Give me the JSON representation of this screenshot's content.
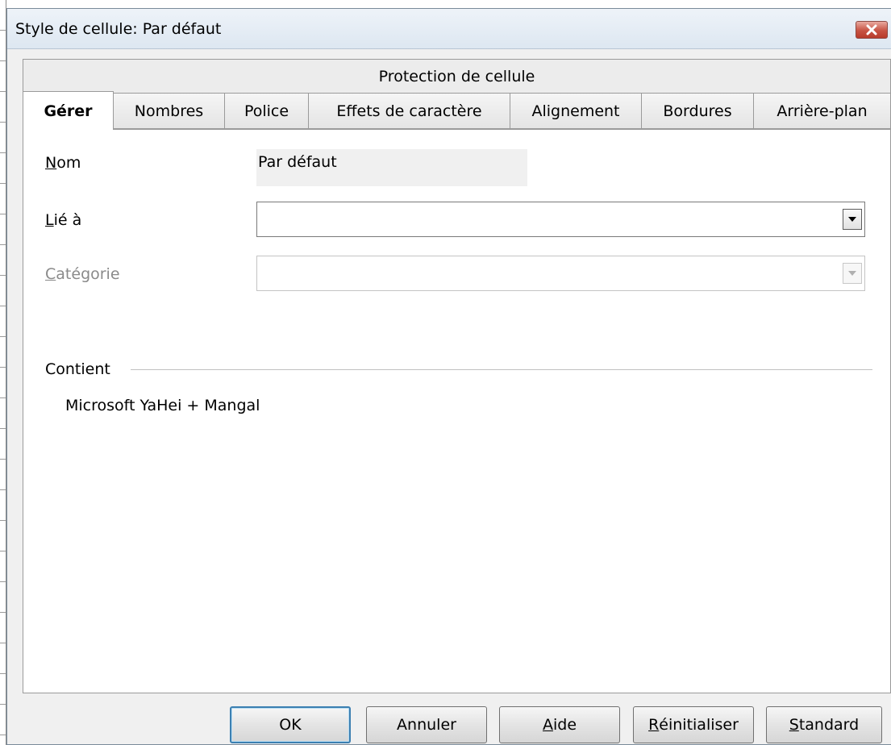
{
  "window": {
    "title": "Style de cellule: Par défaut"
  },
  "tabs": {
    "top_row": [
      "Protection de cellule"
    ],
    "bottom_row": [
      "Gérer",
      "Nombres",
      "Police",
      "Effets de caractère",
      "Alignement",
      "Bordures",
      "Arrière-plan"
    ],
    "active": "Gérer"
  },
  "manage": {
    "name_label_mnemonic": "N",
    "name_label_rest": "om",
    "name_value": "Par défaut",
    "linked_label_mnemonic": "L",
    "linked_label_rest": "ié à",
    "linked_value": "",
    "category_label_mnemonic": "C",
    "category_label_rest": "atégorie",
    "category_value": "",
    "contains_label": "Contient",
    "contains_value": "Microsoft YaHei + Mangal"
  },
  "buttons": {
    "ok": "OK",
    "cancel": "Annuler",
    "help_mnemonic": "A",
    "help_rest": "ide",
    "reset_mnemonic": "R",
    "reset_rest": "éinitialiser",
    "standard_mnemonic": "S",
    "standard_rest": "tandard"
  },
  "icons": {
    "close": "close-icon",
    "dropdown": "chevron-down-icon"
  },
  "colors": {
    "close_button": "#c75343",
    "default_button_border": "#3c7fb1",
    "disabled_text": "#8a8a8a"
  }
}
